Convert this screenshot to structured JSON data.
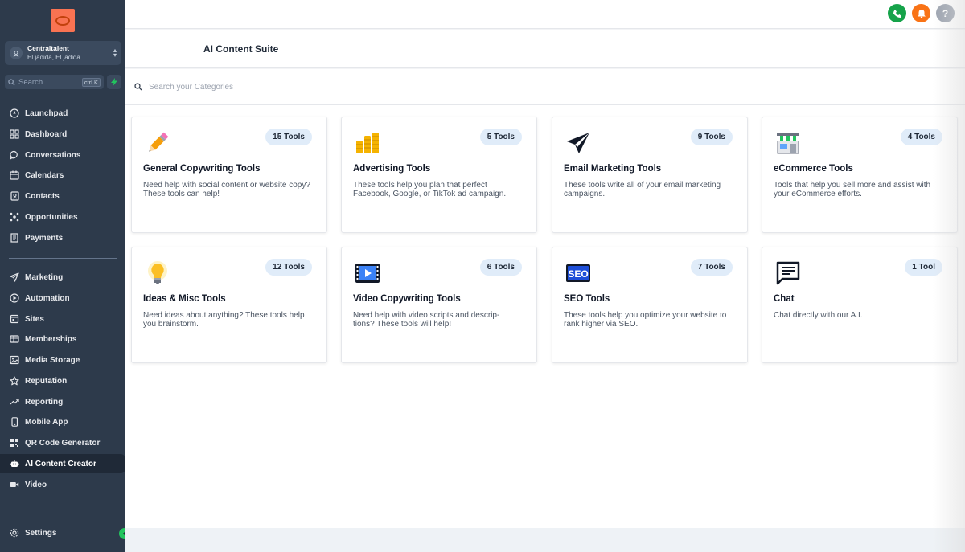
{
  "account": {
    "name": "Centraltalent",
    "location": "El jadida, El jadida"
  },
  "search": {
    "label": "Search",
    "shortcut": "ctrl K"
  },
  "nav": [
    {
      "label": "Launchpad",
      "icon": "launchpad-icon"
    },
    {
      "label": "Dashboard",
      "icon": "dashboard-icon"
    },
    {
      "label": "Conversations",
      "icon": "chat-bubble-icon"
    },
    {
      "label": "Calendars",
      "icon": "calendar-icon"
    },
    {
      "label": "Contacts",
      "icon": "contacts-icon"
    },
    {
      "label": "Opportunities",
      "icon": "opportunities-icon"
    },
    {
      "label": "Payments",
      "icon": "payments-icon"
    },
    {
      "label": "Marketing",
      "icon": "paper-plane-icon"
    },
    {
      "label": "Automation",
      "icon": "automation-icon"
    },
    {
      "label": "Sites",
      "icon": "sites-icon"
    },
    {
      "label": "Memberships",
      "icon": "memberships-icon"
    },
    {
      "label": "Media Storage",
      "icon": "image-icon"
    },
    {
      "label": "Reputation",
      "icon": "star-icon"
    },
    {
      "label": "Reporting",
      "icon": "trend-icon"
    },
    {
      "label": "Mobile App",
      "icon": "mobile-icon"
    },
    {
      "label": "QR Code Generator",
      "icon": "qr-code-icon"
    },
    {
      "label": "AI Content Creator",
      "icon": "robot-icon",
      "active": true
    },
    {
      "label": "Video",
      "icon": "video-camera-icon"
    }
  ],
  "settings": {
    "label": "Settings"
  },
  "topbar": {
    "help": "?",
    "colors": {
      "phone": "#16a34a",
      "bell": "#f97316",
      "help": "#9ca3af"
    }
  },
  "page": {
    "title": "AI Content Suite",
    "search_placeholder": "Search your Categories"
  },
  "cards": [
    {
      "title": "General Copywriting Tools",
      "badge": "15 Tools",
      "desc": "Need help with social content or website copy? These tools can help!",
      "icon": "pencil-icon"
    },
    {
      "title": "Advertising Tools",
      "badge": "5 Tools",
      "desc": "These tools help you plan that perfect Facebook, Google, or TikTok ad campaign.",
      "icon": "coins-icon"
    },
    {
      "title": "Email Marketing Tools",
      "badge": "9 Tools",
      "desc": "These tools write all of your email marketing campaigns.",
      "icon": "paper-plane-icon"
    },
    {
      "title": "eCommerce Tools",
      "badge": "4 Tools",
      "desc": "Tools that help you sell more and assist with your eCommerce efforts.",
      "icon": "store-icon"
    },
    {
      "title": "Ideas & Misc Tools",
      "badge": "12 Tools",
      "desc": "Need ideas about anything? These tools help you brainstorm.",
      "icon": "lightbulb-icon"
    },
    {
      "title": "Video Copywriting Tools",
      "badge": "6 Tools",
      "desc": "Need help with video scripts and descrip- tions? These tools will help!",
      "icon": "video-icon"
    },
    {
      "title": "SEO Tools",
      "badge": "7 Tools",
      "desc": "These tools help you optimize your website to rank higher via SEO.",
      "icon": "seo-icon"
    },
    {
      "title": "Chat",
      "badge": "1 Tool",
      "desc": "Chat directly with our A.I.",
      "icon": "chat-icon"
    }
  ]
}
